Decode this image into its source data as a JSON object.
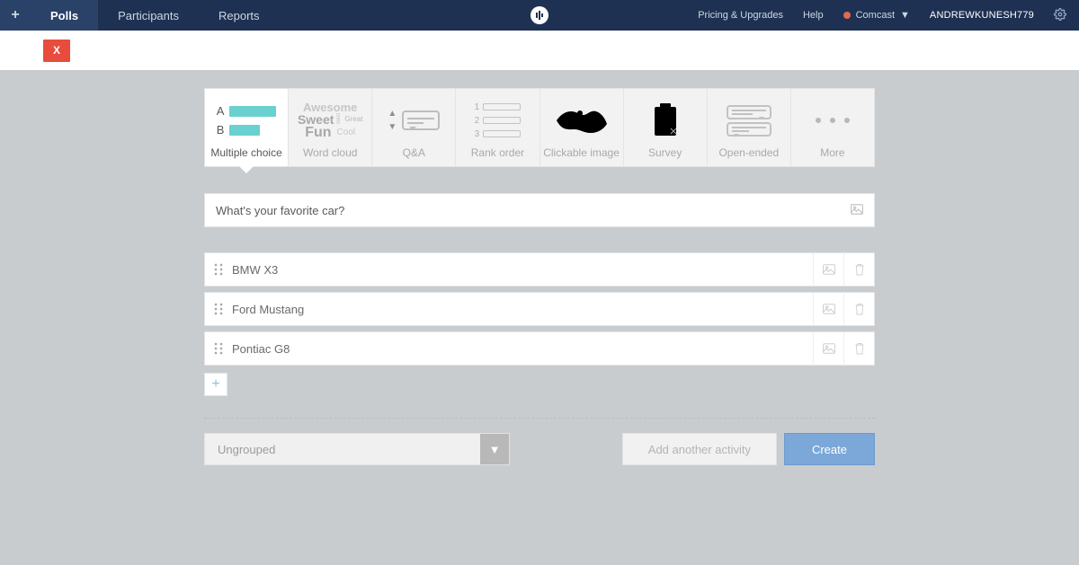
{
  "nav": {
    "plus_label": "+",
    "tabs": [
      "Polls",
      "Participants",
      "Reports"
    ],
    "active_index": 0,
    "pricing": "Pricing & Upgrades",
    "help": "Help",
    "status_label": "Comcast",
    "status_chevron": "▼",
    "username": "ANDREWKUNESH779"
  },
  "secondary": {
    "close_label": "X"
  },
  "type_tabs": [
    "Multiple choice",
    "Word cloud",
    "Q&A",
    "Rank order",
    "Clickable image",
    "Survey",
    "Open-ended",
    "More"
  ],
  "type_active_index": 0,
  "mc_icon": {
    "letters": [
      "A",
      "B"
    ]
  },
  "wordcloud_icon": {
    "awesome": "Awesome",
    "sweet": "Sweet",
    "best": "Best",
    "great": "Great",
    "fun": "Fun",
    "cool": "Cool"
  },
  "rank_icon": {
    "numbers": [
      "1",
      "2",
      "3"
    ]
  },
  "question": "What's your favorite car?",
  "options": [
    "BMW X3",
    "Ford Mustang",
    "Pontiac G8"
  ],
  "add_option_label": "+",
  "group_select": {
    "value": "Ungrouped",
    "chevron": "▼"
  },
  "footer": {
    "add_activity": "Add another activity",
    "create": "Create"
  }
}
